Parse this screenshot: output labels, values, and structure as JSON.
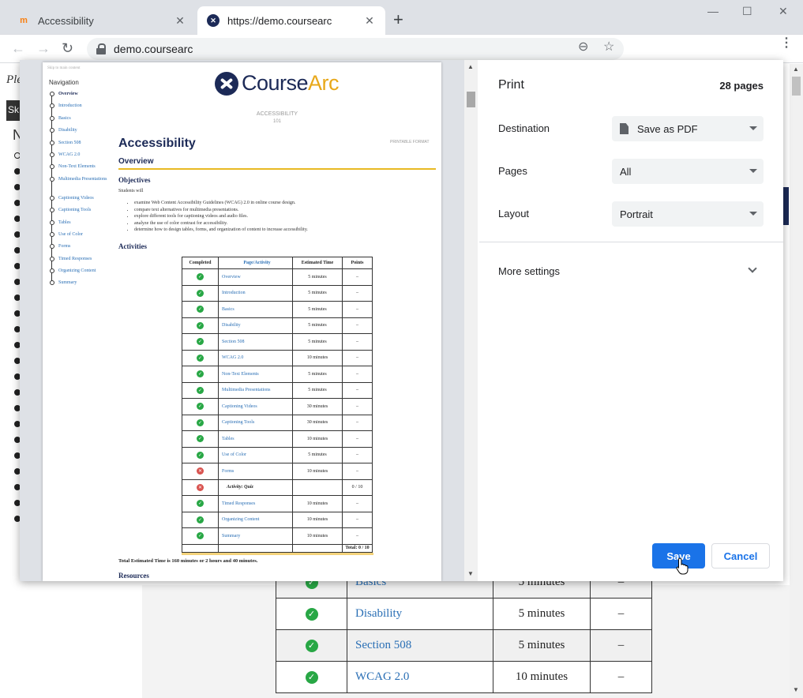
{
  "browser": {
    "tabs": [
      {
        "title": "Accessibility",
        "favicon": "moodle-icon",
        "active": false
      },
      {
        "title": "https://demo.coursearc",
        "favicon": "coursearc-icon",
        "active": true
      }
    ],
    "new_tab": "+",
    "window_controls": {
      "minimize": "—",
      "maximize": "☐",
      "close": "✕"
    },
    "nav": {
      "back": "←",
      "forward": "→",
      "reload": "↻"
    },
    "url": "demo.coursearc",
    "zoom_icon": "⊖",
    "star_icon": "☆",
    "menu_icon": "⋮"
  },
  "behind_page": {
    "left_text": "Ple",
    "skip_text": "Sk",
    "n_letter": "N",
    "table_rows": [
      {
        "activity": "Basics",
        "time": "5 minutes",
        "points": "–",
        "done": true
      },
      {
        "activity": "Disability",
        "time": "5 minutes",
        "points": "–",
        "done": true
      },
      {
        "activity": "Section 508",
        "time": "5 minutes",
        "points": "–",
        "done": true
      },
      {
        "activity": "WCAG 2.0",
        "time": "10 minutes",
        "points": "–",
        "done": true
      }
    ]
  },
  "preview": {
    "skip_link": "Skip to main content",
    "nav_heading": "Navigation",
    "nav_items": [
      "Overview",
      "Introduction",
      "Basics",
      "Disability",
      "Section 508",
      "WCAG 2.0",
      "Non-Text Elements",
      "Multimedia Presentations",
      "Captioning Videos",
      "Captioning Tools",
      "Tables",
      "Use of Color",
      "Forms",
      "Timed Responses",
      "Organizing Content",
      "Summary"
    ],
    "logo": {
      "course": "Course",
      "arc": "Arc"
    },
    "course_name": "ACCESSIBILITY",
    "course_number": "101",
    "printable_format": "PRINTABLE FORMAT",
    "title": "Accessibility",
    "subtitle": "Overview",
    "objectives_heading": "Objectives",
    "students_will": "Students will",
    "objectives": [
      "examine Web Content Accessibility Guidelines (WCAG) 2.0 in online course design.",
      "compare text alternatives for multimedia presentations.",
      "explore different tools for captioning videos and audio files.",
      "analyze the use of color contrast for accessibility.",
      "determine how to design tables, forms, and organization of content to increase accessibility."
    ],
    "activities_heading": "Activities",
    "table_headers": [
      "Completed",
      "Page/Activity",
      "Estimated Time",
      "Points"
    ],
    "table_rows": [
      {
        "status": "done",
        "activity": "Overview",
        "time": "5 minutes",
        "points": "–"
      },
      {
        "status": "done",
        "activity": "Introduction",
        "time": "5 minutes",
        "points": "–"
      },
      {
        "status": "done",
        "activity": "Basics",
        "time": "5 minutes",
        "points": "–"
      },
      {
        "status": "done",
        "activity": "Disability",
        "time": "5 minutes",
        "points": "–"
      },
      {
        "status": "done",
        "activity": "Section 508",
        "time": "5 minutes",
        "points": "–"
      },
      {
        "status": "done",
        "activity": "WCAG 2.0",
        "time": "10 minutes",
        "points": "–"
      },
      {
        "status": "done",
        "activity": "Non-Text Elements",
        "time": "5 minutes",
        "points": "–"
      },
      {
        "status": "done",
        "activity": "Multimedia Presentations",
        "time": "5 minutes",
        "points": "–"
      },
      {
        "status": "done",
        "activity": "Captioning Videos",
        "time": "30 minutes",
        "points": "–"
      },
      {
        "status": "done",
        "activity": "Captioning Tools",
        "time": "30 minutes",
        "points": "–"
      },
      {
        "status": "done",
        "activity": "Tables",
        "time": "10 minutes",
        "points": "–"
      },
      {
        "status": "done",
        "activity": "Use of Color",
        "time": "5 minutes",
        "points": "–"
      },
      {
        "status": "fail",
        "activity": "Forms",
        "time": "10 minutes",
        "points": "–"
      },
      {
        "status": "fail",
        "activity": "Activity: Quiz",
        "time": "",
        "points": "0 / 10",
        "quiz": true
      },
      {
        "status": "done",
        "activity": "Timed Responses",
        "time": "10 minutes",
        "points": "–"
      },
      {
        "status": "done",
        "activity": "Organizing Content",
        "time": "10 minutes",
        "points": "–"
      },
      {
        "status": "done",
        "activity": "Summary",
        "time": "10 minutes",
        "points": "–"
      }
    ],
    "total_points": "Total: 0 / 10",
    "total_time": "Total Estimated Time is 160 minutes or 2 hours and 40 minutes.",
    "resources_heading": "Resources"
  },
  "print": {
    "title": "Print",
    "page_count": "28 pages",
    "destination_label": "Destination",
    "destination_value": "Save as PDF",
    "pages_label": "Pages",
    "pages_value": "All",
    "layout_label": "Layout",
    "layout_value": "Portrait",
    "more_settings": "More settings",
    "save_label": "Save",
    "cancel_label": "Cancel"
  },
  "colors": {
    "accent": "#1a73e8",
    "brand_navy": "#1c2a57",
    "brand_gold": "#e8a81a",
    "check_green": "#28a745",
    "fail_red": "#d9534f"
  }
}
